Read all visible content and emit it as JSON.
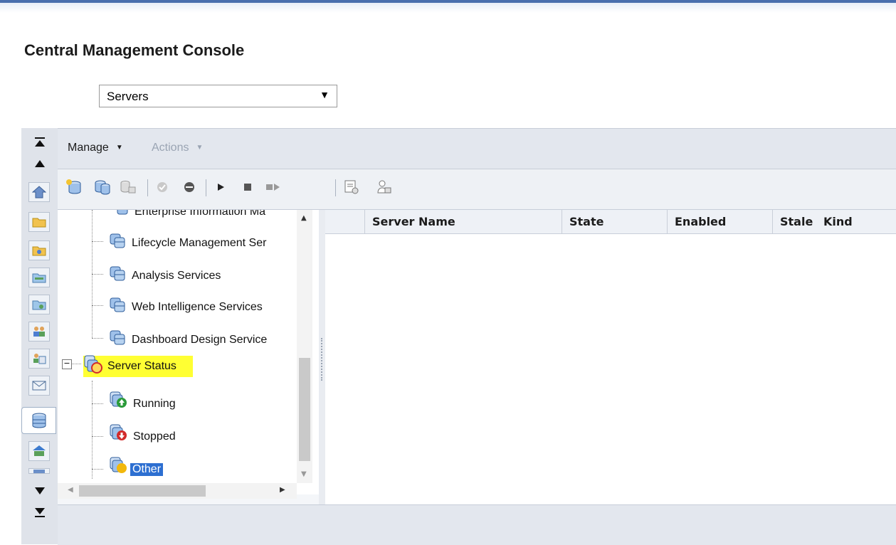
{
  "app": {
    "title": "Central Management Console"
  },
  "selector": {
    "value": "Servers",
    "arrow": "▼"
  },
  "menu": {
    "manage": "Manage",
    "actions": "Actions",
    "caret": "▼"
  },
  "toolbar": {
    "icons": [
      "new-server-icon",
      "clone-server-icon",
      "move-server-icon",
      "enable-icon",
      "disable-icon",
      "start-icon",
      "stop-icon",
      "restart-icon",
      "properties-icon",
      "placeholder-icon"
    ]
  },
  "tree": {
    "items": [
      {
        "label": "Enterprise Information Ma"
      },
      {
        "label": "Lifecycle Management Ser"
      },
      {
        "label": "Analysis Services"
      },
      {
        "label": "Web Intelligence Services"
      },
      {
        "label": "Dashboard Design Service"
      }
    ],
    "server_status": {
      "expander": "−",
      "label": "Server Status",
      "children": [
        {
          "label": "Running"
        },
        {
          "label": "Stopped"
        },
        {
          "label": "Other"
        }
      ]
    }
  },
  "grid": {
    "columns": [
      "",
      "Server Name",
      "State",
      "Enabled",
      "Stale",
      "Kind"
    ]
  },
  "colors": {
    "accent": "#2d6fd1",
    "highlight": "#ffff33",
    "running": "#2a9a3a",
    "stopped": "#d22b2b",
    "other": "#f2b80c"
  },
  "scroll": {
    "up": "▲",
    "down": "▼",
    "left": "◀",
    "right": "▶"
  }
}
